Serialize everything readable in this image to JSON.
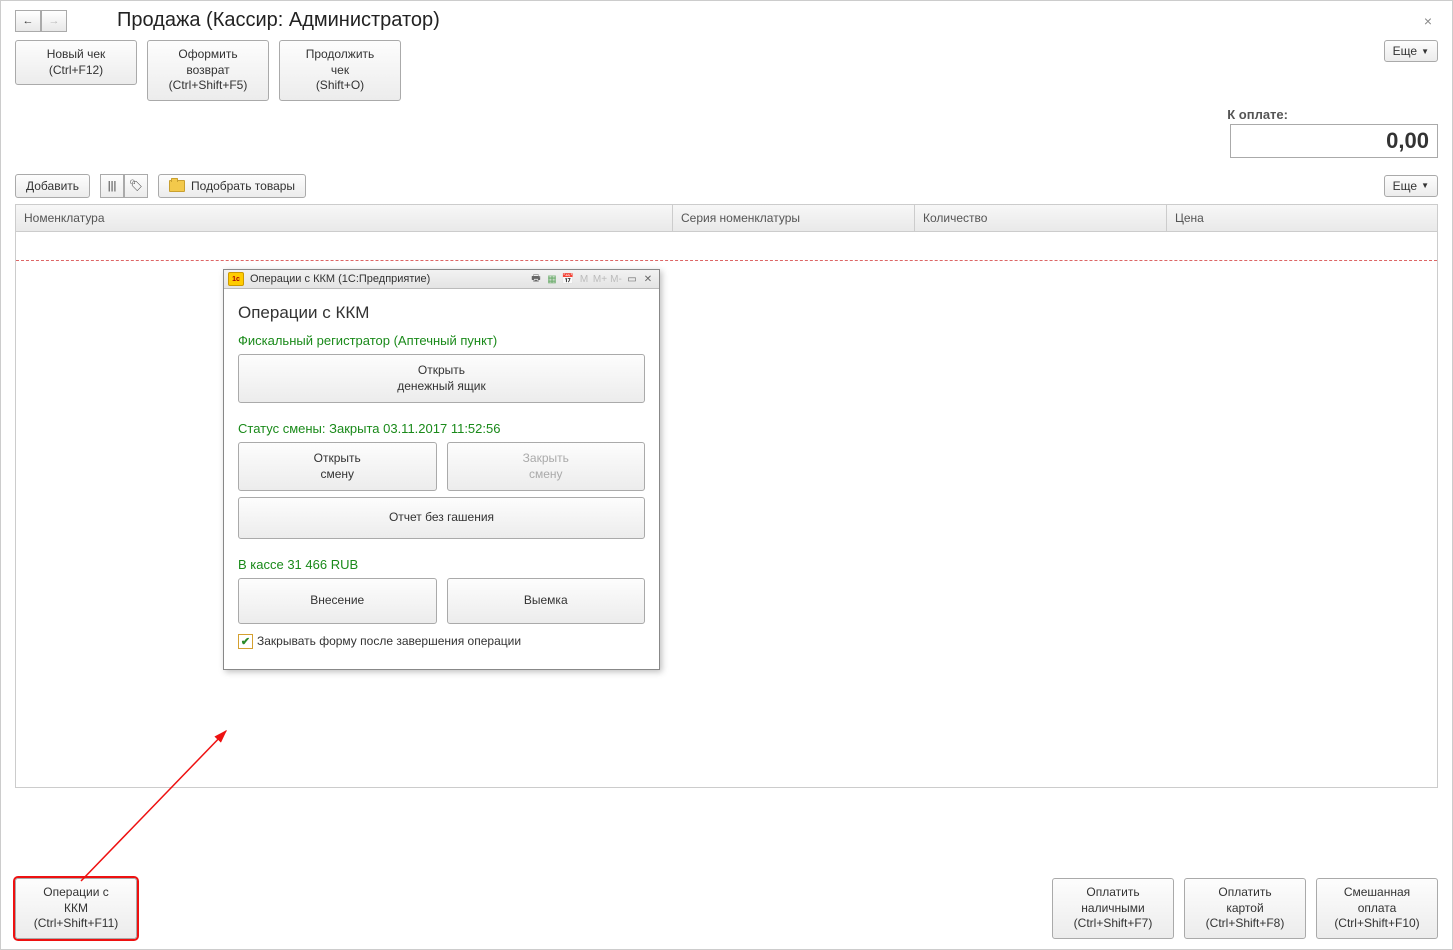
{
  "page_title": "Продажа (Кассир: Администратор)",
  "nav": {
    "back": "←",
    "fwd": "→"
  },
  "toolbar": {
    "new_check_l1": "Новый чек",
    "new_check_l2": "(Ctrl+F12)",
    "return_l1": "Оформить",
    "return_l2": "возврат",
    "return_l3": "(Ctrl+Shift+F5)",
    "continue_l1": "Продолжить",
    "continue_l2": "чек",
    "continue_l3": "(Shift+O)",
    "more": "Еще"
  },
  "pay": {
    "label": "К оплате:",
    "value": "0,00"
  },
  "row2": {
    "add": "Добавить",
    "pick": "Подобрать товары",
    "more": "Еще"
  },
  "columns": {
    "c1": "Номенклатура",
    "c2": "Серия номенклатуры",
    "c3": "Количество",
    "c4": "Цена"
  },
  "bottom": {
    "kkm_l1": "Операции с",
    "kkm_l2": "ККМ",
    "kkm_l3": "(Ctrl+Shift+F11)",
    "cash_l1": "Оплатить",
    "cash_l2": "наличными",
    "cash_l3": "(Ctrl+Shift+F7)",
    "card_l1": "Оплатить",
    "card_l2": "картой",
    "card_l3": "(Ctrl+Shift+F8)",
    "mix_l1": "Смешанная",
    "mix_l2": "оплата",
    "mix_l3": "(Ctrl+Shift+F10)"
  },
  "modal": {
    "title": "Операции с ККМ  (1С:Предприятие)",
    "m_letters": {
      "m": "M",
      "mp": "M+",
      "mm": "M-"
    },
    "heading": "Операции с ККМ",
    "registrar": "Фискальный регистратор (Аптечный пункт)",
    "open_drawer_l1": "Открыть",
    "open_drawer_l2": "денежный ящик",
    "shift_status": "Статус смены: Закрыта 03.11.2017 11:52:56",
    "open_shift_l1": "Открыть",
    "open_shift_l2": "смену",
    "close_shift_l1": "Закрыть",
    "close_shift_l2": "смену",
    "xreport": "Отчет без гашения",
    "in_cash": "В кассе 31 466 RUB",
    "deposit": "Внесение",
    "withdraw": "Выемка",
    "close_after": "Закрывать форму после завершения операции"
  }
}
